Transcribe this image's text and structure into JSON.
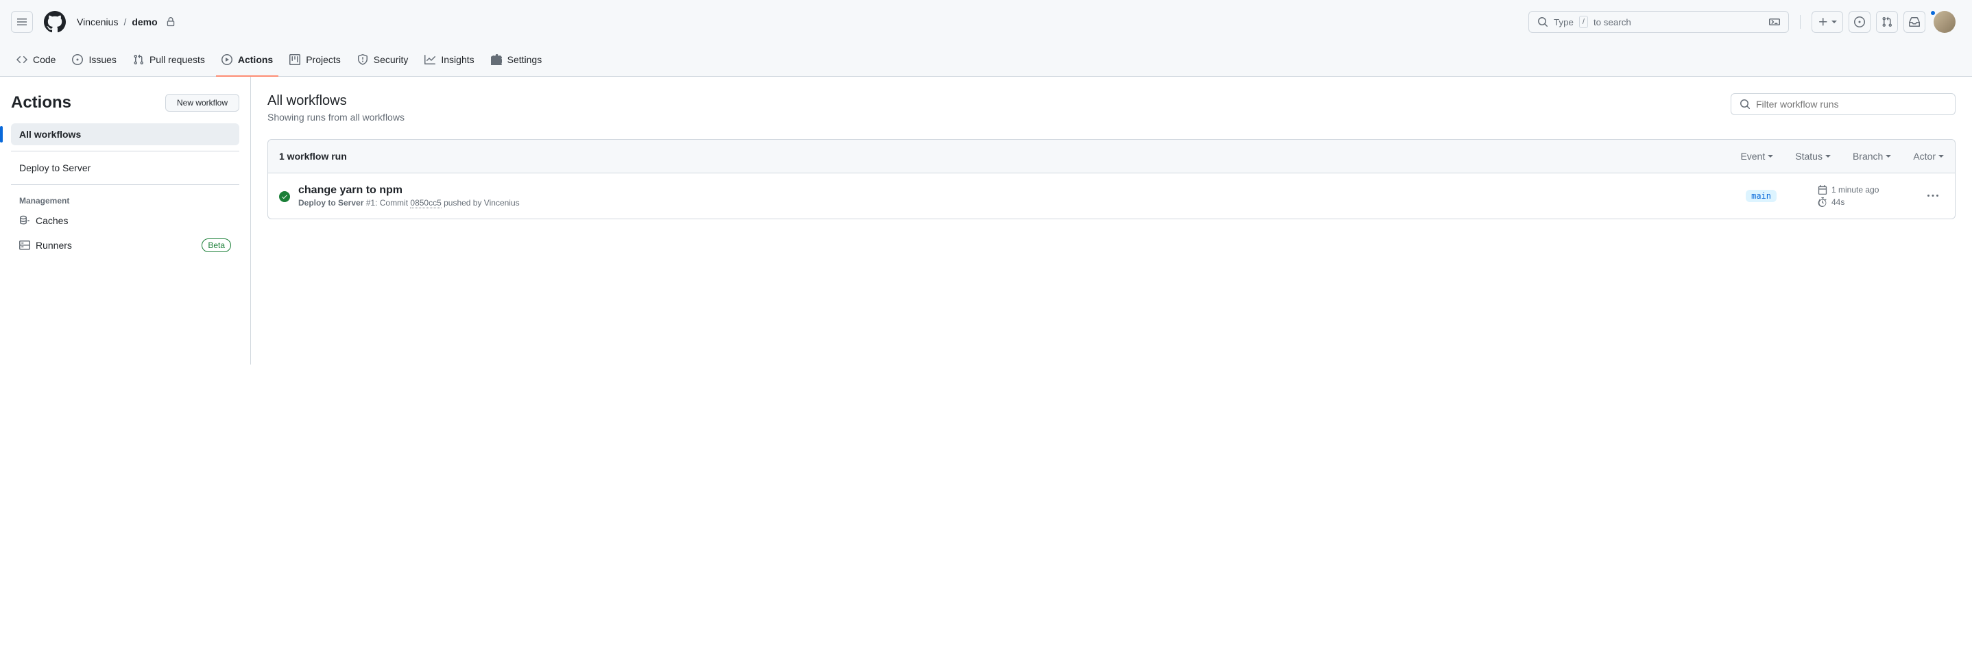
{
  "header": {
    "owner": "Vincenius",
    "separator": "/",
    "repo": "demo",
    "search_prefix": "Type",
    "search_key": "/",
    "search_suffix": "to search"
  },
  "tabs": {
    "code": "Code",
    "issues": "Issues",
    "pulls": "Pull requests",
    "actions": "Actions",
    "projects": "Projects",
    "security": "Security",
    "insights": "Insights",
    "settings": "Settings"
  },
  "sidebar": {
    "title": "Actions",
    "new_workflow": "New workflow",
    "all_workflows": "All workflows",
    "workflow_item": "Deploy to Server",
    "management": "Management",
    "caches": "Caches",
    "runners": "Runners",
    "beta": "Beta"
  },
  "content": {
    "title": "All workflows",
    "subtitle": "Showing runs from all workflows",
    "filter_placeholder": "Filter workflow runs",
    "list_header": "1 workflow run",
    "filters": {
      "event": "Event",
      "status": "Status",
      "branch": "Branch",
      "actor": "Actor"
    },
    "run": {
      "title": "change yarn to npm",
      "workflow": "Deploy to Server",
      "run_number": " #1:",
      "commit_prefix": " Commit ",
      "commit_sha": "0850cc5",
      "pushed_by": " pushed by Vincenius",
      "branch": "main",
      "time": "1 minute ago",
      "duration": "44s"
    }
  }
}
